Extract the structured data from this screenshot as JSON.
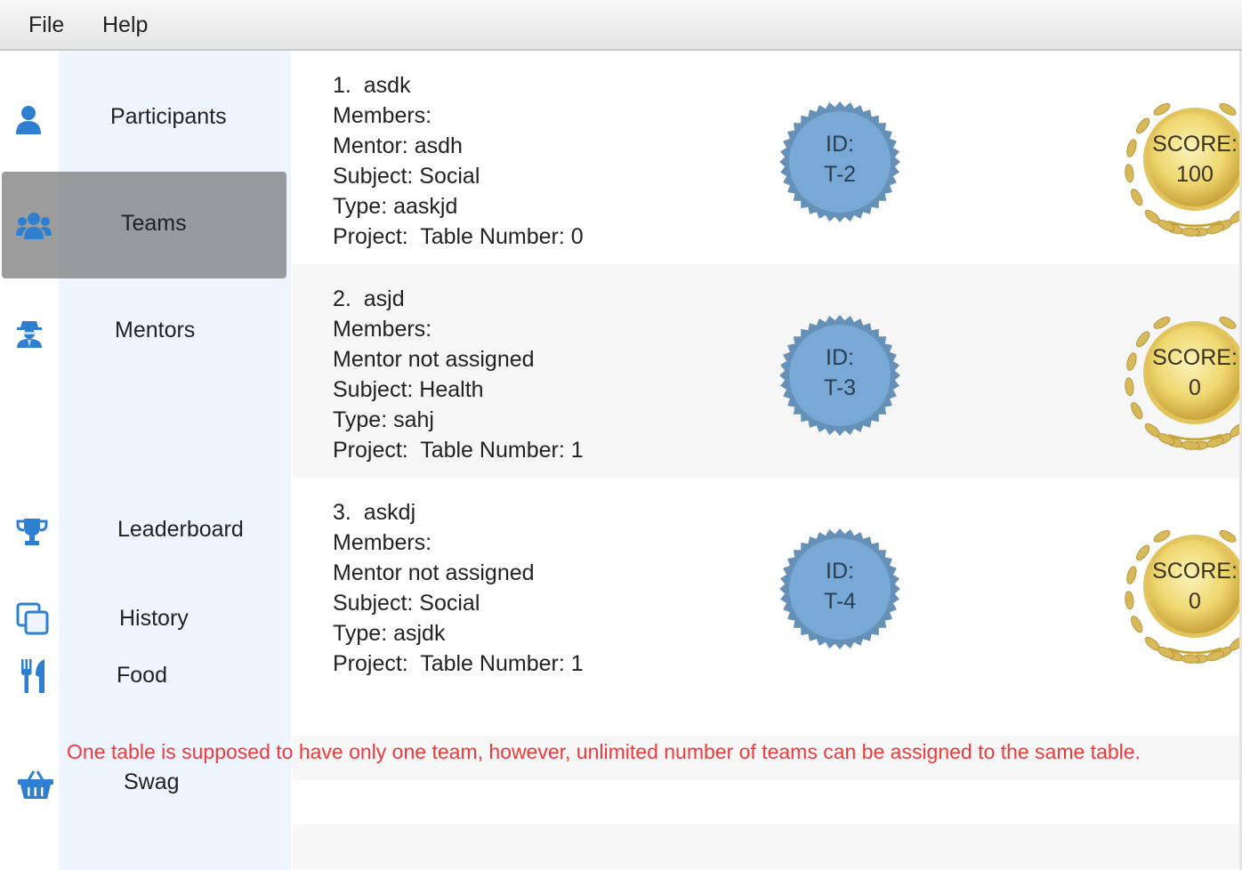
{
  "menu": {
    "file": "File",
    "help": "Help"
  },
  "sidebar": {
    "items": [
      {
        "label": "Participants",
        "icon": "user-icon"
      },
      {
        "label": "Teams",
        "icon": "users-icon",
        "selected": true
      },
      {
        "label": "Mentors",
        "icon": "user-secret-icon"
      },
      {
        "label": "Leaderboard",
        "icon": "trophy-icon"
      },
      {
        "label": "History",
        "icon": "copy-icon"
      },
      {
        "label": "Food",
        "icon": "cutlery-icon"
      },
      {
        "label": "Swag",
        "icon": "shopping-basket-icon"
      }
    ]
  },
  "teams": [
    {
      "number": "1.",
      "name": "asdk",
      "members": "Members:",
      "mentor": "Mentor: asdh",
      "subject": "Subject: Social",
      "type": "Type: aaskjd",
      "project": "Project:  Table Number: 0",
      "id_label": "ID:",
      "id": "T-2",
      "score_label": "SCORE:",
      "score": "100"
    },
    {
      "number": "2.",
      "name": "asjd",
      "members": "Members:",
      "mentor": "Mentor not assigned",
      "subject": "Subject: Health",
      "type": "Type: sahj",
      "project": "Project:  Table Number: 1",
      "id_label": "ID:",
      "id": "T-3",
      "score_label": "SCORE:",
      "score": "0"
    },
    {
      "number": "3.",
      "name": "askdj",
      "members": "Members:",
      "mentor": "Mentor not assigned",
      "subject": "Subject: Social",
      "type": "Type: asjdk",
      "project": "Project:  Table Number: 1",
      "id_label": "ID:",
      "id": "T-4",
      "score_label": "SCORE:",
      "score": "0"
    }
  ],
  "annotation": "One table is supposed to have only one team, however, unlimited number of teams can be assigned to the same table.",
  "colors": {
    "accent_icon": "#2f7fd1",
    "id_badge": "#77a8d6",
    "id_badge_edge": "#6590b8",
    "warning": "#f03a3a",
    "selected": "#8a8a8a"
  }
}
